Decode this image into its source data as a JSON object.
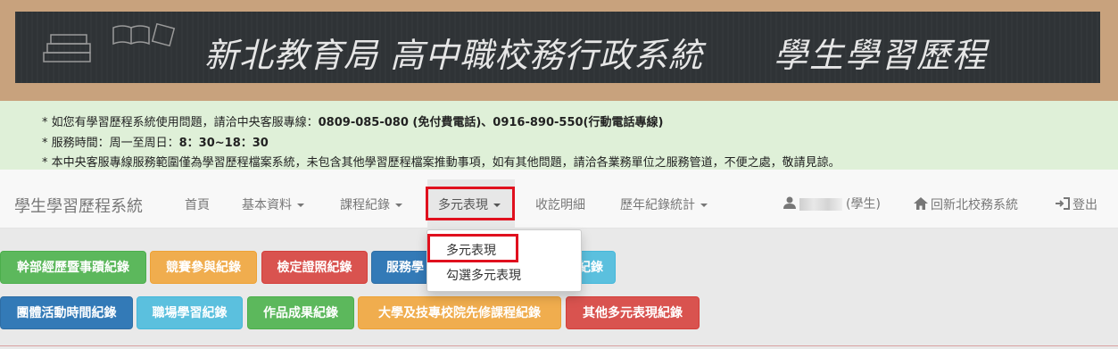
{
  "banner": {
    "title": "新北教育局 高中職校務行政系統",
    "subtitle": "學生學習歷程"
  },
  "notice": {
    "line1_pre": "* 如您有學習歷程系統使用問題，請洽中央客服專線：",
    "line1_bold": "0809-085-080 (免付費電話)、0916-890-550(行動電話專線)",
    "line2_pre": "* 服務時間：周一至周日：",
    "line2_bold": "8：30~18：30",
    "line3": "* 本中央客服專線服務範圍僅為學習歷程檔案系統，未包含其他學習歷程檔案推動事項，如有其他問題，請洽各業務單位之服務管道，不便之處，敬請見諒。"
  },
  "navbar": {
    "brand": "學生學習歷程系統",
    "items": [
      {
        "label": "首頁"
      },
      {
        "label": "基本資料"
      },
      {
        "label": "課程紀錄"
      },
      {
        "label": "多元表現"
      },
      {
        "label": "收訖明細"
      },
      {
        "label": "歷年紀錄統計"
      }
    ],
    "user_role": "(學生)",
    "back_label": "回新北校務系統",
    "logout_label": "登出"
  },
  "dropdown": {
    "items": [
      {
        "label": "多元表現"
      },
      {
        "label": "勾選多元表現"
      }
    ]
  },
  "buttons_row1": [
    {
      "label": "幹部經歷暨事蹟紀錄",
      "color": "#5cb85c"
    },
    {
      "label": "競賽參與紀錄",
      "color": "#f0ad4e"
    },
    {
      "label": "檢定證照紀錄",
      "color": "#d9534f"
    },
    {
      "label": "服務學",
      "color": "#337ab7"
    },
    {
      "label": "紀錄",
      "color": "#5bc0de"
    }
  ],
  "buttons_row2": [
    {
      "label": "團體活動時間紀錄",
      "color": "#337ab7"
    },
    {
      "label": "職場學習紀錄",
      "color": "#5bc0de"
    },
    {
      "label": "作品成果紀錄",
      "color": "#5cb85c"
    },
    {
      "label": "大學及技專校院先修課程紀錄",
      "color": "#f0ad4e"
    },
    {
      "label": "其他多元表現紀錄",
      "color": "#d9534f"
    }
  ]
}
